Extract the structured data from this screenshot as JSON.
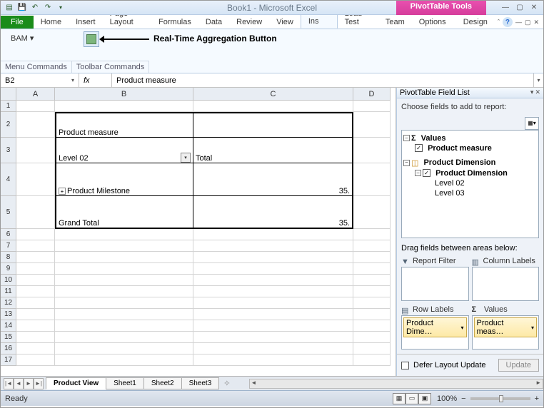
{
  "title": "Book1 - Microsoft Excel",
  "pivot_tools_label": "PivotTable Tools",
  "qat": {
    "save": "💾",
    "undo": "↶",
    "redo": "↷"
  },
  "tabs": {
    "file": "File",
    "items": [
      "Home",
      "Insert",
      "Page Layout",
      "Formulas",
      "Data",
      "Review",
      "View",
      "Add-Ins",
      "Load Test",
      "Team",
      "Options",
      "Design"
    ],
    "active": "Add-Ins"
  },
  "ribbon": {
    "bam_label": "BAM ▾",
    "annotation": "Real-Time Aggregation Button",
    "group1": "Menu Commands",
    "group2": "Toolbar Commands"
  },
  "namebox": "B2",
  "fx_label": "fx",
  "formula": "Product measure",
  "columns": [
    "A",
    "B",
    "C",
    "D"
  ],
  "rows_small_h": 16,
  "pivot": {
    "b2": "Product measure",
    "b3": "Level 02",
    "c3": "Total",
    "b4": "Product Milestone",
    "c4": "35.",
    "b5": "Grand Total",
    "c5": "35."
  },
  "fieldlist": {
    "title": "PivotTable Field List",
    "choose": "Choose fields to add to report:",
    "values_label": "Values",
    "measure": "Product measure",
    "dim": "Product Dimension",
    "dim_child": "Product Dimension",
    "level02": "Level 02",
    "level03": "Level 03",
    "drag_label": "Drag fields between areas below:",
    "area_filter": "Report Filter",
    "area_cols": "Column Labels",
    "area_rows": "Row Labels",
    "area_vals": "Values",
    "chip_rows": "Product Dime…",
    "chip_vals": "Product meas…",
    "defer": "Defer Layout Update",
    "update": "Update",
    "sigma": "Σ"
  },
  "sheets": {
    "active": "Product View",
    "others": [
      "Sheet1",
      "Sheet2",
      "Sheet3"
    ]
  },
  "status": {
    "ready": "Ready",
    "zoom": "100%"
  }
}
